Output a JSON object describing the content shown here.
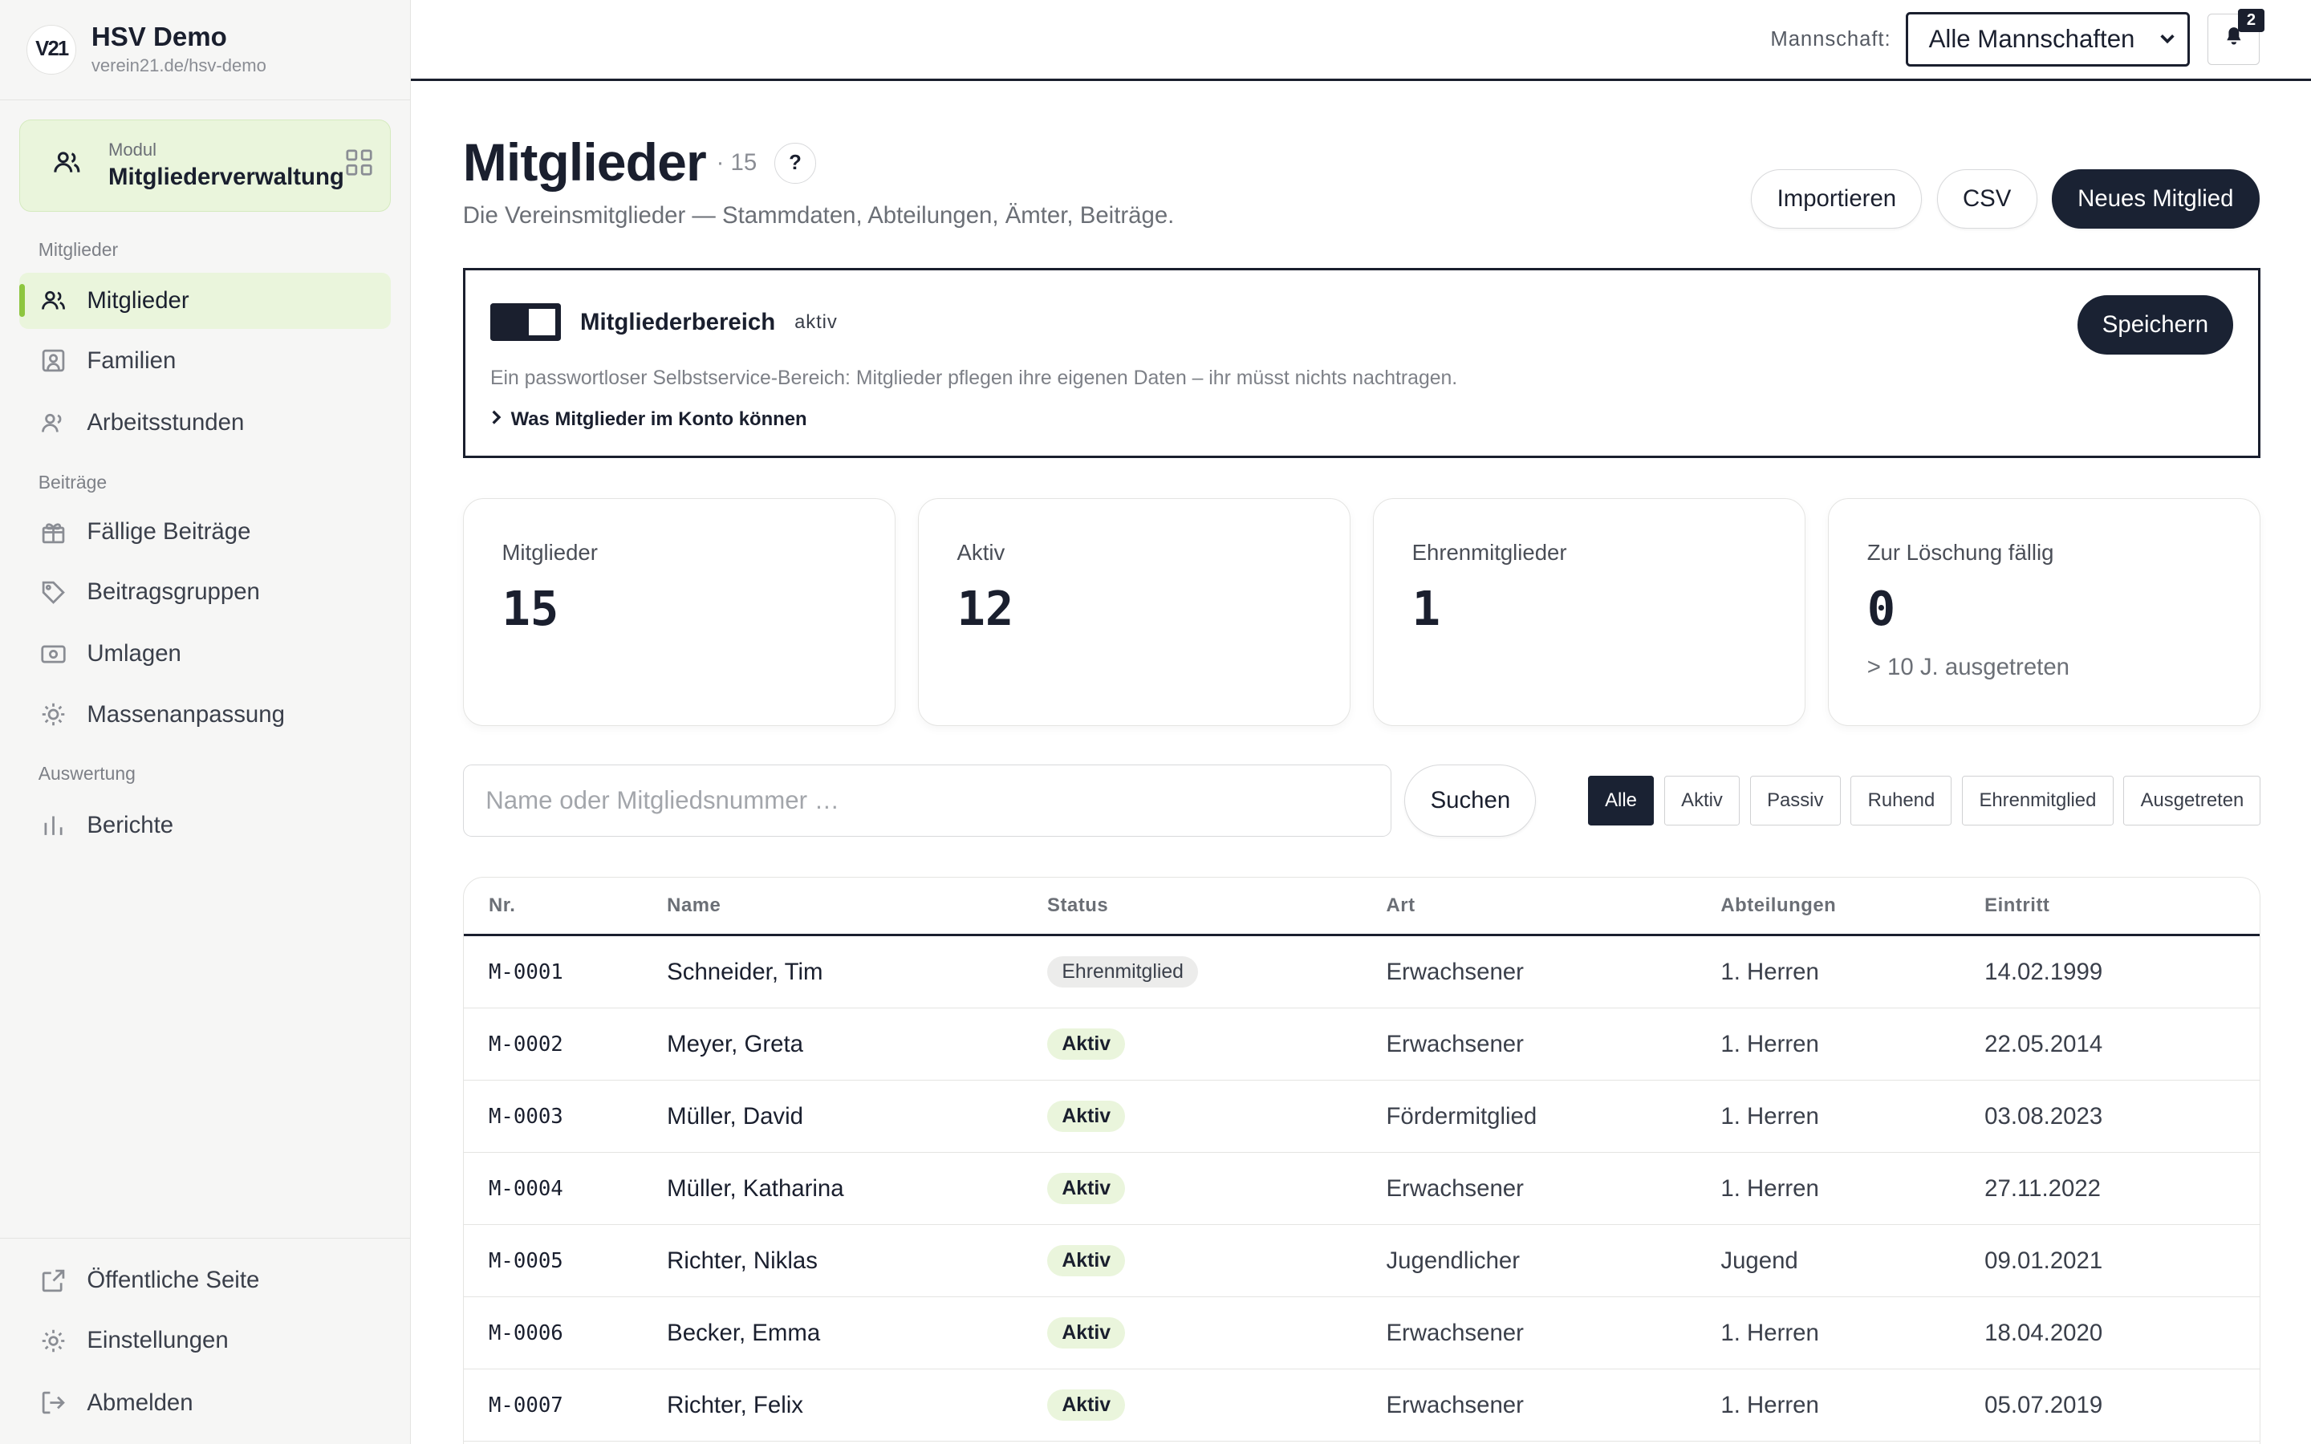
{
  "brand": {
    "logo_text": "V21",
    "title": "HSV Demo",
    "subtitle": "verein21.de/hsv-demo"
  },
  "module": {
    "caption": "Modul",
    "name": "Mitgliederverwaltung"
  },
  "sidebar": {
    "sections": [
      {
        "label": "Mitglieder"
      },
      {
        "label": "Beiträge"
      },
      {
        "label": "Auswertung"
      }
    ],
    "items": [
      {
        "label": "Mitglieder",
        "icon": "users-icon",
        "active": true
      },
      {
        "label": "Familien",
        "icon": "family-icon"
      },
      {
        "label": "Arbeitsstunden",
        "icon": "worker-icon"
      },
      {
        "label": "Fällige Beiträge",
        "icon": "gift-icon"
      },
      {
        "label": "Beitragsgruppen",
        "icon": "tag-icon"
      },
      {
        "label": "Umlagen",
        "icon": "money-icon"
      },
      {
        "label": "Massenanpassung",
        "icon": "sun-icon"
      },
      {
        "label": "Berichte",
        "icon": "bar-chart-icon"
      }
    ],
    "bottom": [
      {
        "label": "Öffentliche Seite",
        "icon": "external-link-icon"
      },
      {
        "label": "Einstellungen",
        "icon": "gear-icon"
      },
      {
        "label": "Abmelden",
        "icon": "logout-icon"
      }
    ]
  },
  "topbar": {
    "team_label": "Mannschaft:",
    "team_value": "Alle Mannschaften",
    "notifications": "2"
  },
  "page": {
    "title": "Mitglieder",
    "count": "· 15",
    "help": "?",
    "description": "Die Vereinsmitglieder — Stammdaten, Abteilungen, Ämter, Beiträge.",
    "actions": {
      "import": "Importieren",
      "csv": "CSV",
      "new": "Neues Mitglied"
    }
  },
  "member_area": {
    "title": "Mitgliederbereich",
    "status": "aktiv",
    "save": "Speichern",
    "description": "Ein passwortloser Selbstservice-Bereich: Mitglieder pflegen ihre eigenen Daten – ihr müsst nichts nachtragen.",
    "link": "Was Mitglieder im Konto können"
  },
  "stats": [
    {
      "label": "Mitglieder",
      "value": "15",
      "sub": ""
    },
    {
      "label": "Aktiv",
      "value": "12",
      "sub": ""
    },
    {
      "label": "Ehrenmitglieder",
      "value": "1",
      "sub": ""
    },
    {
      "label": "Zur Löschung fällig",
      "value": "0",
      "sub": "> 10 J. ausgetreten"
    }
  ],
  "search": {
    "placeholder": "Name oder Mitgliedsnummer …",
    "button": "Suchen"
  },
  "filters": [
    "Alle",
    "Aktiv",
    "Passiv",
    "Ruhend",
    "Ehrenmitglied",
    "Ausgetreten"
  ],
  "table": {
    "headers": {
      "nr": "Nr.",
      "name": "Name",
      "status": "Status",
      "art": "Art",
      "abteilungen": "Abteilungen",
      "eintritt": "Eintritt"
    },
    "rows": [
      {
        "nr": "M-0001",
        "name": "Schneider, Tim",
        "status": "Ehrenmitglied",
        "art": "Erwachsener",
        "abteilungen": "1. Herren",
        "eintritt": "14.02.1999"
      },
      {
        "nr": "M-0002",
        "name": "Meyer, Greta",
        "status": "Aktiv",
        "art": "Erwachsener",
        "abteilungen": "1. Herren",
        "eintritt": "22.05.2014"
      },
      {
        "nr": "M-0003",
        "name": "Müller, David",
        "status": "Aktiv",
        "art": "Fördermitglied",
        "abteilungen": "1. Herren",
        "eintritt": "03.08.2023"
      },
      {
        "nr": "M-0004",
        "name": "Müller, Katharina",
        "status": "Aktiv",
        "art": "Erwachsener",
        "abteilungen": "1. Herren",
        "eintritt": "27.11.2022"
      },
      {
        "nr": "M-0005",
        "name": "Richter, Niklas",
        "status": "Aktiv",
        "art": "Jugendlicher",
        "abteilungen": "Jugend",
        "eintritt": "09.01.2021"
      },
      {
        "nr": "M-0006",
        "name": "Becker, Emma",
        "status": "Aktiv",
        "art": "Erwachsener",
        "abteilungen": "1. Herren",
        "eintritt": "18.04.2020"
      },
      {
        "nr": "M-0007",
        "name": "Richter, Felix",
        "status": "Aktiv",
        "art": "Erwachsener",
        "abteilungen": "1. Herren",
        "eintritt": "05.07.2019"
      }
    ]
  }
}
